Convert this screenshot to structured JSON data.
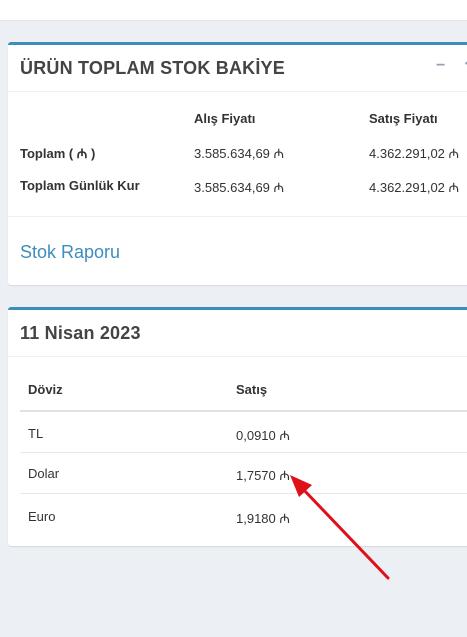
{
  "stock_box": {
    "title": "ÜRÜN TOPLAM STOK BAKİYE",
    "minimize_glyph": "−",
    "headers": {
      "buy": "Alış Fiyatı",
      "sell": "Satış Fiyatı"
    },
    "rows": [
      {
        "label": "Toplam ( ₼ )",
        "buy": "3.585.634,69 ₼",
        "sell": "4.362.291,02 ₼"
      },
      {
        "label": "Toplam Günlük Kur",
        "buy": "3.585.634,69 ₼",
        "sell": "4.362.291,02 ₼"
      }
    ],
    "report_link": "Stok Raporu"
  },
  "rates_box": {
    "title": "11 Nisan 2023",
    "headers": {
      "currency": "Döviz",
      "sell": "Satış"
    },
    "rows": [
      {
        "currency": "TL",
        "sell": "0,0910 ₼"
      },
      {
        "currency": "Dolar",
        "sell": "1,7570 ₼"
      },
      {
        "currency": "Euro",
        "sell": "1,9180 ₼"
      }
    ]
  },
  "colors": {
    "accent": "#3c8dbc",
    "annotation_arrow": "#e0101a",
    "background": "#ecf0f5"
  },
  "icons": [
    "minimize-icon",
    "collapse-icon"
  ]
}
